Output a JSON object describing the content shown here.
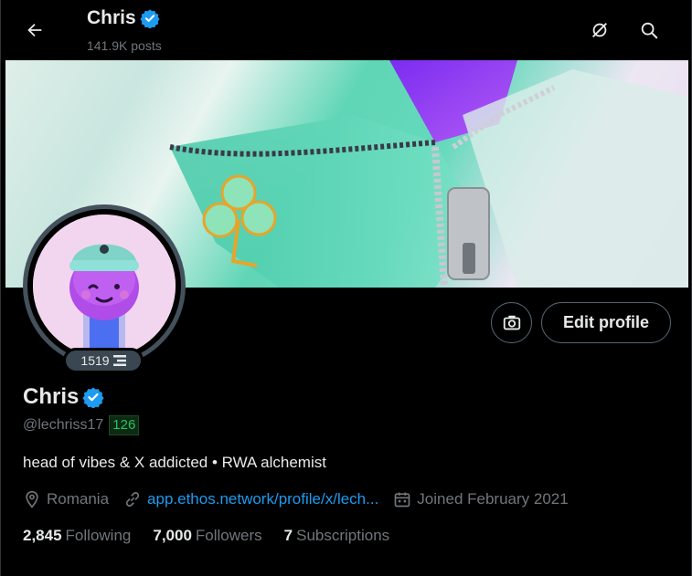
{
  "header": {
    "name": "Chris",
    "posts_count": "141.9K posts",
    "back_icon": "arrow-left-icon",
    "grok_icon": "grok-icon",
    "search_icon": "search-icon"
  },
  "profile": {
    "name": "Chris",
    "handle": "@lechriss17",
    "score_badge": "126",
    "avatar_badge": "1519",
    "bio": "head of vibes & X addicted • RWA alchemist",
    "location": "Romania",
    "website": "app.ethos.network/profile/x/lech...",
    "joined": "Joined February 2021",
    "verified_color": "#1d9bf0"
  },
  "actions": {
    "edit_profile_label": "Edit profile",
    "camera_icon": "camera-icon"
  },
  "stats": {
    "following_count": "2,845",
    "following_label": "Following",
    "followers_count": "7,000",
    "followers_label": "Followers",
    "subscriptions_count": "7",
    "subscriptions_label": "Subscriptions"
  },
  "colors": {
    "background": "#000000",
    "text_primary": "#e7e9ea",
    "text_secondary": "#71767b",
    "link": "#1d9bf0",
    "score_green": "#29c25a"
  }
}
